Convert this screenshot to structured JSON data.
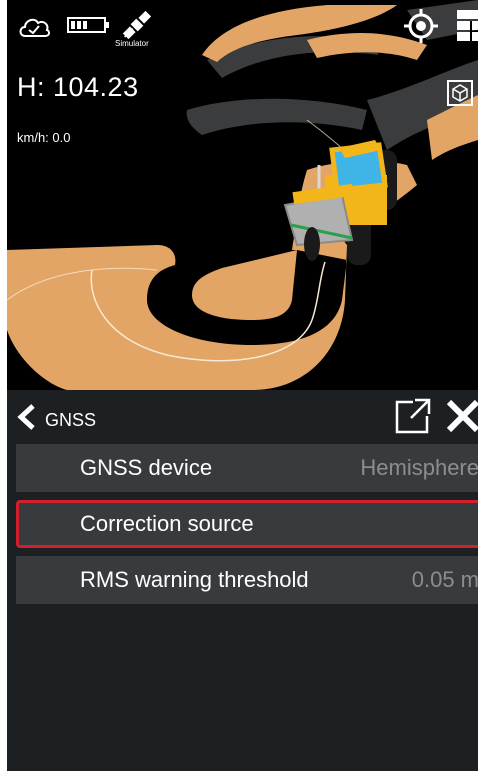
{
  "hud": {
    "height_readout": "H: 104.23",
    "speed_readout": "km/h: 0.0",
    "simulator_label": "Simulator"
  },
  "icons": {
    "cloud": "cloud-check-icon",
    "battery": "battery-icon",
    "satellite": "satellite-icon",
    "locate": "locate-icon",
    "layers": "layers-icon",
    "view_cube": "view-cube-icon",
    "back": "chevron-left-icon",
    "popout": "open-external-icon",
    "close": "close-icon"
  },
  "panel": {
    "title": "GNSS",
    "rows": [
      {
        "label": "GNSS device",
        "value": "Hemisphere"
      },
      {
        "label": "Correction source",
        "value": ""
      },
      {
        "label": "RMS warning threshold",
        "value": "0.05 m"
      }
    ]
  },
  "colors": {
    "road_surface": "#e2a565",
    "asphalt": "#3a3c3e",
    "panel_bg": "#1d2022",
    "row_bg": "#383b3d",
    "highlight_border": "#d0202a",
    "loader_yellow": "#f2b51a",
    "loader_cab": "#3fb4e6"
  }
}
